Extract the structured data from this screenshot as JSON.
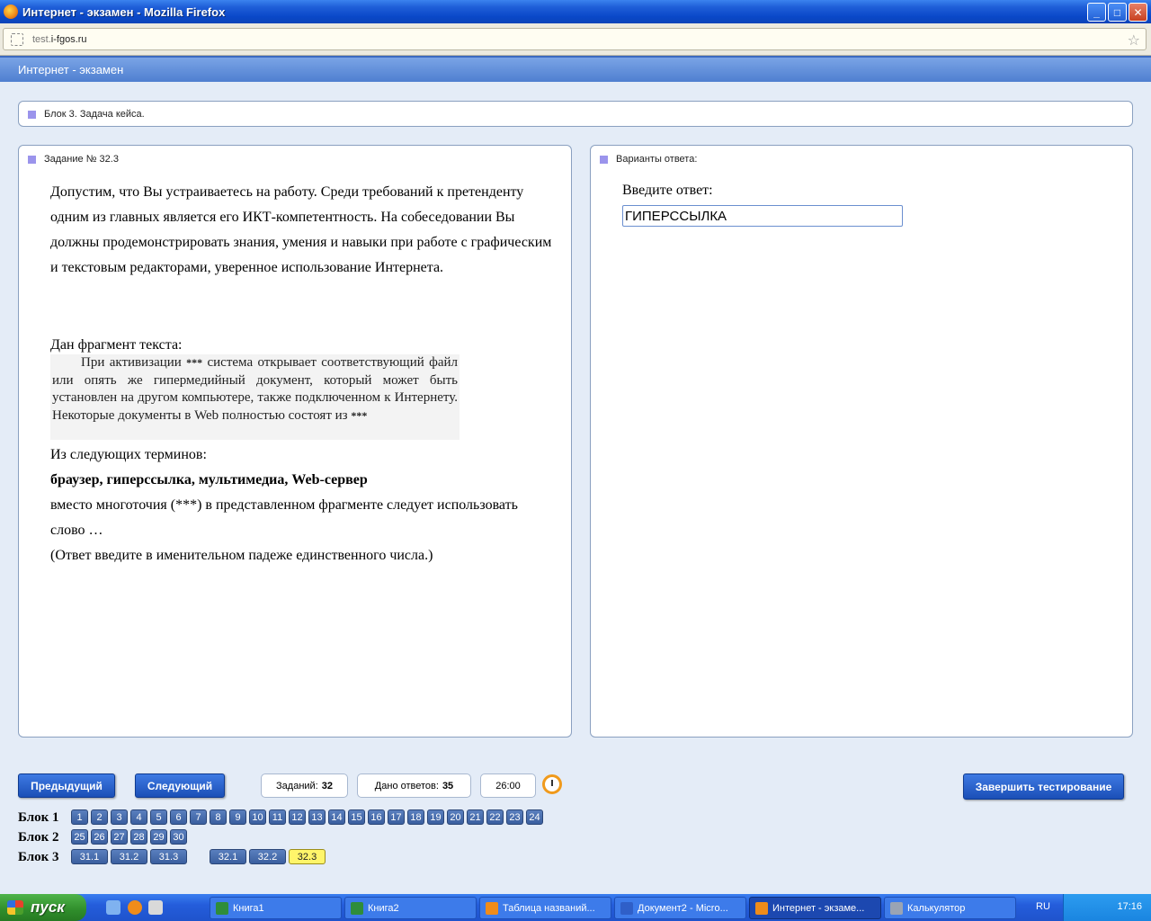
{
  "window": {
    "title": "Интернет - экзамен - Mozilla Firefox",
    "min": "_",
    "max": "□",
    "close": "✕"
  },
  "address": {
    "host_prefix": "test.",
    "host_main": "i-fgos.ru"
  },
  "app": {
    "header": "Интернет - экзамен"
  },
  "block_bar": {
    "label": "Блок 3. Задача кейса."
  },
  "task": {
    "header": "Задание № 32.3",
    "intro": "Допустим, что Вы устраиваетесь на работу. Среди требований к претенденту одним из главных является его ИКТ-компетентность. На собеседовании Вы должны продемонстрировать знания, умения и навыки при работе с графическим и текстовым редакторами, уверенное использование Интернета.",
    "given": "Дан фрагмент текста:",
    "fragment_part1": "При активизации",
    "fragment_stars": "***",
    "fragment_part2": "система открывает соответствующий файл или опять же гипермедийный документ, который может быть установлен на другом компьютере, также подключенном к Интернету. Некоторые документы в Web полностью состоят из",
    "from_terms": "Из следующих терминов:",
    "terms": "браузер, гиперссылка, мультимедиа, Web-сервер",
    "after": "вместо многоточия (***) в представленном фрагменте следует использовать слово …",
    "note": "(Ответ введите в именительном падеже единственного числа.)"
  },
  "answers": {
    "header": "Варианты ответа:",
    "prompt": "Введите ответ:",
    "value": "ГИПЕРССЫЛКА"
  },
  "nav": {
    "prev": "Предыдущий",
    "next": "Следующий",
    "tasks_label": "Заданий:",
    "tasks_value": "32",
    "answered_label": "Дано ответов:",
    "answered_value": "35",
    "timer": "26:00",
    "finish": "Завершить тестирование"
  },
  "blocks": {
    "b1_label": "Блок 1",
    "b2_label": "Блок 2",
    "b3_label": "Блок 3",
    "b1": [
      "1",
      "2",
      "3",
      "4",
      "5",
      "6",
      "7",
      "8",
      "9",
      "10",
      "11",
      "12",
      "13",
      "14",
      "15",
      "16",
      "17",
      "18",
      "19",
      "20",
      "21",
      "22",
      "23",
      "24"
    ],
    "b2": [
      "25",
      "26",
      "27",
      "28",
      "29",
      "30"
    ],
    "b3": [
      "31.1",
      "31.2",
      "31.3",
      "32.1",
      "32.2",
      "32.3"
    ],
    "active": "32.3"
  },
  "taskbar": {
    "start": "пуск",
    "items": [
      "Книга1",
      "Книга2",
      "Таблица названий...",
      "Документ2 - Micro...",
      "Интернет - экзаме...",
      "Калькулятор"
    ],
    "lang": "RU",
    "time": "17:16"
  }
}
